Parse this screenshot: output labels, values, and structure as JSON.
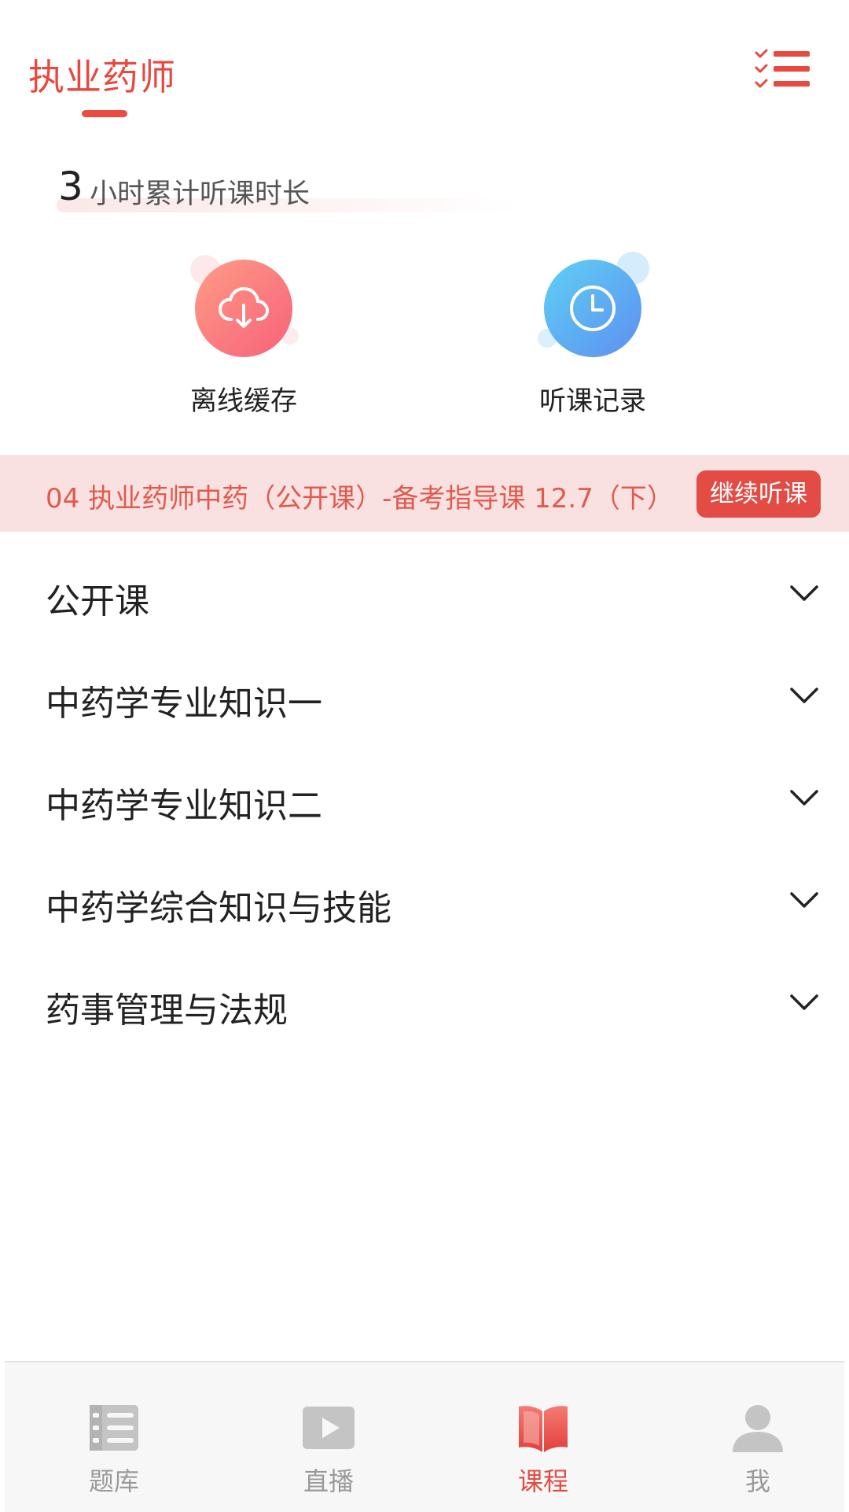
{
  "header": {
    "title": "执业药师",
    "menu_icon": "checklist-menu-icon"
  },
  "stats": {
    "hours": "3",
    "label": "小时累计听课时长"
  },
  "shortcuts": [
    {
      "label": "离线缓存",
      "icon": "cloud-download-icon",
      "color": "#f7617a"
    },
    {
      "label": "听课记录",
      "icon": "clock-icon",
      "color": "#5fa8f5"
    }
  ],
  "banner": {
    "text": "04 执业药师中药（公开课）-备考指导课 12.7（下）",
    "button": "继续听课"
  },
  "courses": [
    {
      "label": "公开课"
    },
    {
      "label": "中药学专业知识一"
    },
    {
      "label": "中药学专业知识二"
    },
    {
      "label": "中药学综合知识与技能"
    },
    {
      "label": "药事管理与法规"
    }
  ],
  "tabbar": {
    "tabs": [
      {
        "label": "题库",
        "icon": "question-bank-icon",
        "active": false
      },
      {
        "label": "直播",
        "icon": "play-icon",
        "active": false
      },
      {
        "label": "课程",
        "icon": "book-icon",
        "active": true
      },
      {
        "label": "我",
        "icon": "user-icon",
        "active": false
      }
    ]
  },
  "colors": {
    "accent": "#e24c44",
    "banner_bg": "#f9e1e1",
    "inactive_tab": "#9a9a9a"
  }
}
